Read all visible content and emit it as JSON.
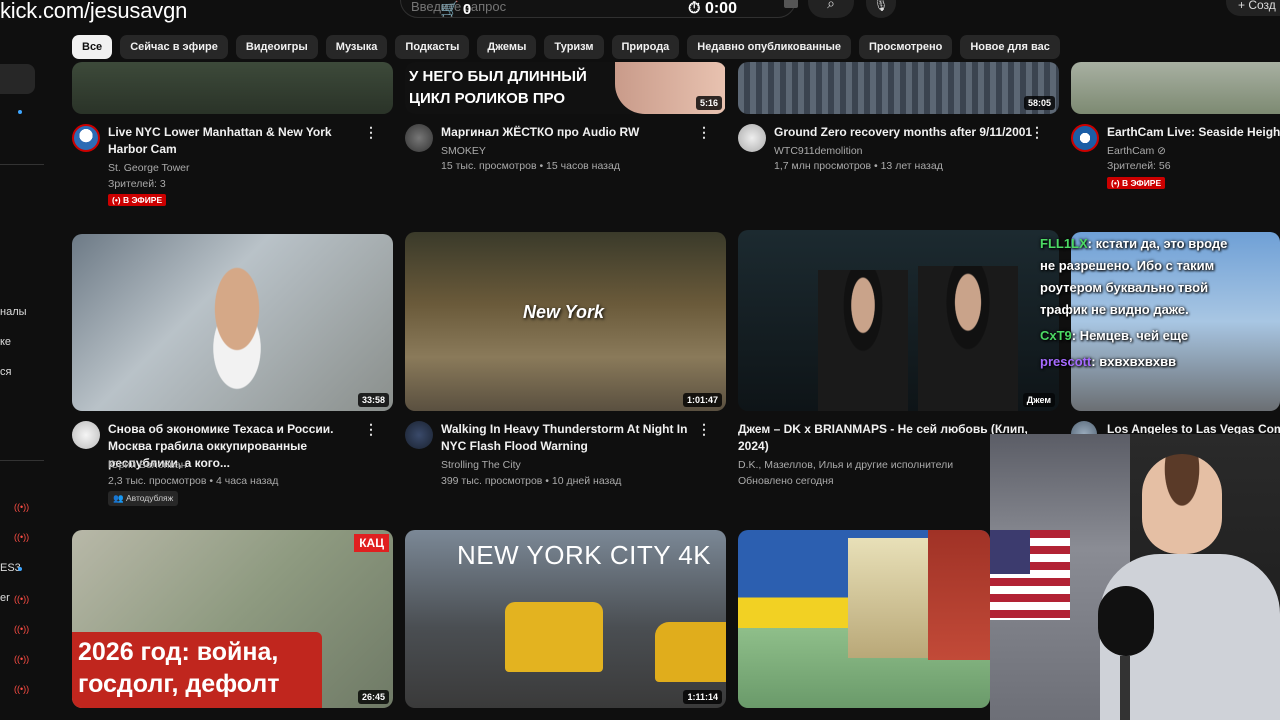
{
  "stream": {
    "url": "kick.com/jesusavgn",
    "cart_count": "0",
    "timer": "0:00"
  },
  "search": {
    "placeholder": "Введите запрос"
  },
  "header": {
    "create_label": "+ Созд"
  },
  "sidebar": {
    "texts": [
      "налы",
      "ке",
      "ся",
      "ES3",
      "er"
    ]
  },
  "chips": [
    "Все",
    "Сейчас в эфире",
    "Видеоигры",
    "Музыка",
    "Подкасты",
    "Джемы",
    "Туризм",
    "Природа",
    "Недавно опубликованные",
    "Просмотрено",
    "Новое для вас"
  ],
  "row1": [
    {
      "title": "Live NYC Lower Manhattan & New York Harbor Cam",
      "channel": "St. George Tower",
      "stats": "Зрителей: 3",
      "live": "(•) В ЭФИРЕ",
      "thumb_text": ""
    },
    {
      "title": "Маргинал ЖЁСТКО про Audio RW",
      "channel": "SMOKEY",
      "stats": "15 тыс. просмотров • 15 часов назад",
      "duration": "5:16",
      "thumb_text": "У НЕГО БЫЛ ДЛИННЫЙ ЦИКЛ РОЛИКОВ ПРО МЕНЯ"
    },
    {
      "title": "Ground Zero recovery months after 9/11/2001",
      "channel": "WTC911demolition",
      "stats": "1,7 млн просмотров • 13 лет назад",
      "duration": "58:05"
    },
    {
      "title": "EarthCam Live: Seaside Heights",
      "channel": "EarthCam ⊘",
      "stats": "Зрителей: 56",
      "live": "(•) В ЭФИРЕ"
    }
  ],
  "row2": [
    {
      "title": "Снова об экономике Техаса и России. Москва грабила оккупированные республики, а кого...",
      "channel": "Юрий Белойван",
      "stats": "2,3 тыс. просмотров • 4 часа назад",
      "dub": "Автодубляж",
      "duration": "33:58"
    },
    {
      "title": "Walking In Heavy Thunderstorm At Night In NYC Flash Flood Warning",
      "channel": "Strolling The City",
      "stats": "399 тыс. просмотров • 10 дней назад",
      "duration": "1:01:47",
      "thumb_text": "New York"
    },
    {
      "title": "Джем – DK x BRIANMAPS - Не сей любовь (Клип, 2024)",
      "channel": "D.K., Мазеллов, Илья и другие исполнители",
      "stats": "Обновлено сегодня",
      "duration": "Джем"
    },
    {
      "title": "Los Angeles to Las Vegas Comp"
    }
  ],
  "row3": [
    {
      "duration": "26:45",
      "thumb_text": "2026 год: война, госдолг, дефолт",
      "badge": "КАЦ"
    },
    {
      "duration": "1:11:14",
      "thumb_text": "NEW YORK CITY 4K"
    },
    {}
  ],
  "chat": [
    {
      "user": "FLL1LX",
      "text": ": кстати да, это вроде"
    },
    {
      "user": "",
      "text": "не разрешено. Ибо с таким"
    },
    {
      "user": "",
      "text": "роутером буквально твой"
    },
    {
      "user": "",
      "text": "трафик не видно даже."
    },
    {
      "user": "CxT9",
      "text": ": Немцев, чей еще"
    },
    {
      "user": "prescott",
      "text": ": вхвхвхвхвв"
    }
  ],
  "colors": {
    "bg": "#0f0f0f",
    "chip": "#272727",
    "live": "#cc0000",
    "meta": "#aaaaaa"
  }
}
